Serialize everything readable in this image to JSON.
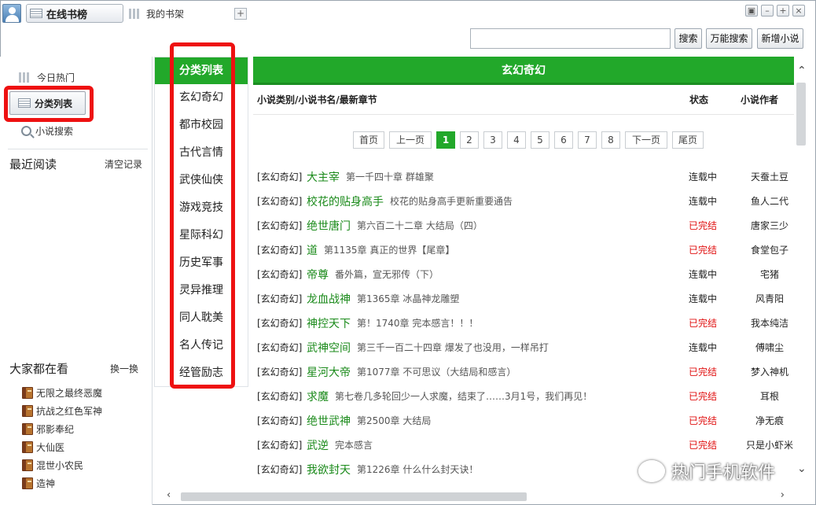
{
  "titlebar": {
    "tab_online": "在线书榜",
    "tab_shelf": "我的书架",
    "add_tab": "+",
    "window_buttons": [
      "▣",
      "–",
      "+",
      "×"
    ]
  },
  "search": {
    "value": "",
    "search_btn": "搜索",
    "universal_btn": "万能搜索",
    "new_novel_btn": "新增小说"
  },
  "sidebar": {
    "today_hot": "今日热门",
    "category_list": "分类列表",
    "novel_search": "小说搜索",
    "recent_reading": "最近阅读",
    "clear_records": "清空记录",
    "everyone_reading": "大家都在看",
    "refresh": "换一换",
    "popular_books": [
      "无限之最终恶魔",
      "抗战之红色军神",
      "邪影奉纪",
      "大仙医",
      "混世小农民",
      "造神"
    ]
  },
  "categories": {
    "header": "分类列表",
    "items": [
      "玄幻奇幻",
      "都市校园",
      "古代言情",
      "武侠仙侠",
      "游戏竞技",
      "星际科幻",
      "历史军事",
      "灵异推理",
      "同人耽美",
      "名人传记",
      "经管励志"
    ]
  },
  "main": {
    "title": "玄幻奇幻",
    "col_info": "小说类别/小说书名/最新章节",
    "col_status": "状态",
    "col_author": "小说作者",
    "pager": {
      "first": "首页",
      "prev": "上一页",
      "pages": [
        "1",
        "2",
        "3",
        "4",
        "5",
        "6",
        "7",
        "8"
      ],
      "current": "1",
      "next": "下一页",
      "last": "尾页"
    },
    "rows": [
      {
        "cat": "[玄幻奇幻]",
        "name": "大主宰",
        "chapter": "第一千四十章 群雄聚",
        "status": "连载中",
        "author": "天蚕土豆"
      },
      {
        "cat": "[玄幻奇幻]",
        "name": "校花的贴身高手",
        "chapter": "校花的贴身高手更新重要通告",
        "status": "连载中",
        "author": "鱼人二代"
      },
      {
        "cat": "[玄幻奇幻]",
        "name": "绝世唐门",
        "chapter": "第六百二十二章 大结局（四）",
        "status": "已完结",
        "author": "唐家三少"
      },
      {
        "cat": "[玄幻奇幻]",
        "name": "道",
        "chapter": "第1135章 真正的世界【尾章】",
        "status": "已完结",
        "author": "食堂包子"
      },
      {
        "cat": "[玄幻奇幻]",
        "name": "帝尊",
        "chapter": "番外篇，宣无邪传（下）",
        "status": "连载中",
        "author": "宅猪"
      },
      {
        "cat": "[玄幻奇幻]",
        "name": "龙血战神",
        "chapter": "第1365章 冰晶神龙雕塑",
        "status": "连载中",
        "author": "风青阳"
      },
      {
        "cat": "[玄幻奇幻]",
        "name": "神控天下",
        "chapter": "第！1740章 完本感言！！！",
        "status": "已完结",
        "author": "我本纯洁"
      },
      {
        "cat": "[玄幻奇幻]",
        "name": "武神空间",
        "chapter": "第三千一百二十四章 爆发了也没用，一样吊打",
        "status": "连载中",
        "author": "傅啸尘"
      },
      {
        "cat": "[玄幻奇幻]",
        "name": "星河大帝",
        "chapter": "第1077章 不可思议（大结局和感言）",
        "status": "已完结",
        "author": "梦入神机"
      },
      {
        "cat": "[玄幻奇幻]",
        "name": "求魔",
        "chapter": "第七卷几多轮回少一人求魔，结束了……3月1号，我们再见！",
        "status": "已完结",
        "author": "耳根"
      },
      {
        "cat": "[玄幻奇幻]",
        "name": "绝世武神",
        "chapter": "第2500章 大结局",
        "status": "已完结",
        "author": "净无痕"
      },
      {
        "cat": "[玄幻奇幻]",
        "name": "武逆",
        "chapter": "完本感言",
        "status": "已完结",
        "author": "只是小虾米"
      },
      {
        "cat": "[玄幻奇幻]",
        "name": "我欲封天",
        "chapter": "第1226章 什么什么封天诀！",
        "status": "",
        "author": ""
      }
    ]
  },
  "watermark": "热门手机软件",
  "colors": {
    "accent_green": "#22a82a",
    "completed_red": "#e01010",
    "highlight_red": "#ee1111"
  }
}
